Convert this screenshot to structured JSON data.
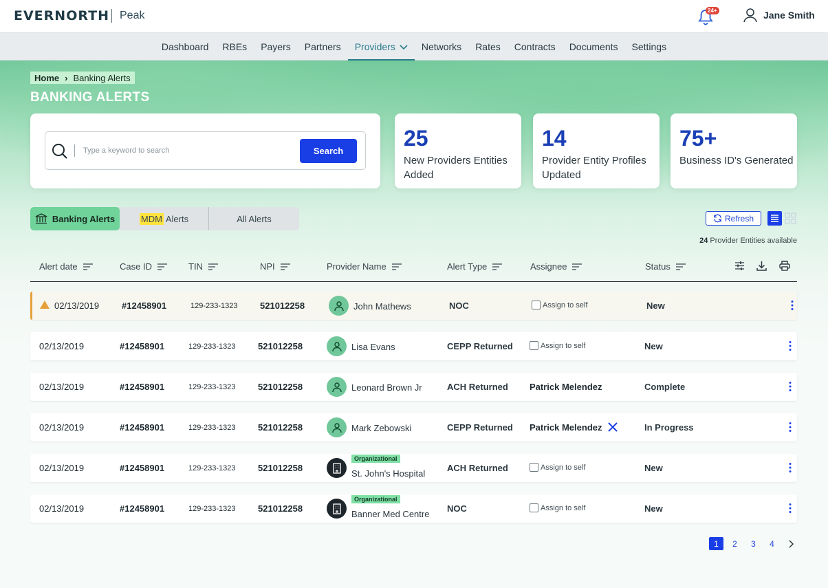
{
  "header": {
    "logo": "EVERNORTH",
    "product": "Peak",
    "notification_badge": "24+",
    "user_name": "Jane Smith"
  },
  "nav": {
    "items": [
      "Dashboard",
      "RBEs",
      "Payers",
      "Partners",
      "Providers",
      "Networks",
      "Rates",
      "Contracts",
      "Documents",
      "Settings"
    ],
    "active": "Providers"
  },
  "breadcrumb": {
    "home": "Home",
    "current": "Banking Alerts"
  },
  "page_title": "BANKING ALERTS",
  "search": {
    "placeholder": "Type a keyword to search",
    "button": "Search"
  },
  "stats": [
    {
      "value": "25",
      "label": "New Providers Entities Added"
    },
    {
      "value": "14",
      "label": "Provider Entity Profiles Updated"
    },
    {
      "value": "75+",
      "label": "Business ID's Generated"
    }
  ],
  "tabs": {
    "banking": "Banking Alerts",
    "mdm_highlight": "MDM",
    "mdm_rest": " Alerts",
    "all": "All Alerts"
  },
  "toolbar": {
    "refresh": "Refresh",
    "available_count": "24",
    "available_text": "Provider Entities available"
  },
  "table": {
    "columns": [
      "Alert date",
      "Case ID",
      "TIN",
      "NPI",
      "Provider Name",
      "Alert Type",
      "Assignee",
      "Status"
    ],
    "rows": [
      {
        "date": "02/13/2019",
        "case_id": "#12458901",
        "tin": "129-233-1323",
        "npi": "521012258",
        "provider": "John Mathews",
        "kind": "person",
        "alert_type": "NOC",
        "assignee": "",
        "status": "New"
      },
      {
        "date": "02/13/2019",
        "case_id": "#12458901",
        "tin": "129-233-1323",
        "npi": "521012258",
        "provider": "Lisa Evans",
        "kind": "person",
        "alert_type": "CEPP Returned",
        "assignee": "",
        "status": "New"
      },
      {
        "date": "02/13/2019",
        "case_id": "#12458901",
        "tin": "129-233-1323",
        "npi": "521012258",
        "provider": "Leonard Brown Jr",
        "kind": "person",
        "alert_type": "ACH Returned",
        "assignee": "Patrick Melendez",
        "status": "Complete"
      },
      {
        "date": "02/13/2019",
        "case_id": "#12458901",
        "tin": "129-233-1323",
        "npi": "521012258",
        "provider": "Mark Zebowski",
        "kind": "person",
        "alert_type": "CEPP Returned",
        "assignee": "Patrick Melendez",
        "status": "In Progress"
      },
      {
        "date": "02/13/2019",
        "case_id": "#12458901",
        "tin": "129-233-1323",
        "npi": "521012258",
        "provider": "St. John's Hospital",
        "kind": "org",
        "org_tag": "Organizational",
        "alert_type": "ACH Returned",
        "assignee": "",
        "status": "New"
      },
      {
        "date": "02/13/2019",
        "case_id": "#12458901",
        "tin": "129-233-1323",
        "npi": "521012258",
        "provider": "Banner Med Centre",
        "kind": "org",
        "org_tag": "Organizational",
        "alert_type": "NOC",
        "assignee": "",
        "status": "New"
      }
    ],
    "assign_label": "Assign to self"
  },
  "pagination": {
    "pages": [
      "1",
      "2",
      "3",
      "4"
    ],
    "current": "1"
  },
  "colors": {
    "accent": "#1a3ee6",
    "brand_green": "#6fd39a",
    "warning": "#e6a23a"
  }
}
